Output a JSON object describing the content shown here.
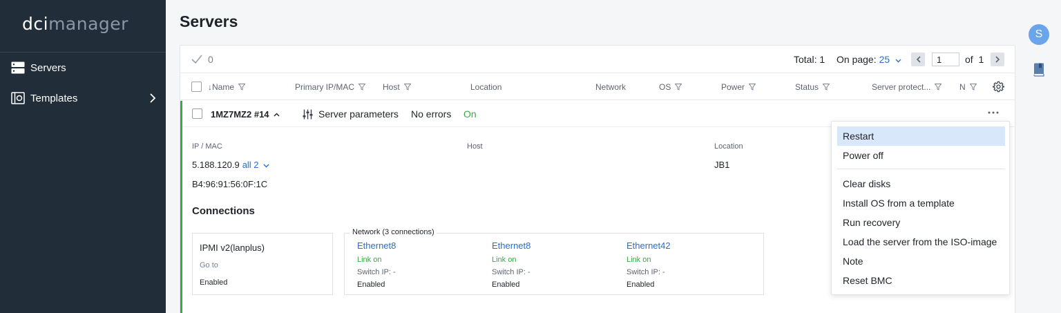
{
  "app": {
    "logo_part1": "dci",
    "logo_part2": "manager"
  },
  "sidebar": {
    "items": [
      {
        "label": "Servers",
        "icon": "servers-icon"
      },
      {
        "label": "Templates",
        "icon": "templates-icon"
      }
    ]
  },
  "user": {
    "avatar_letter": "S"
  },
  "page": {
    "title": "Servers"
  },
  "toolbar": {
    "selected_count": "0",
    "total": "Total: 1",
    "on_page_label": "On page:",
    "on_page_value": "25",
    "page_input": "1",
    "of_text": "of  1"
  },
  "table": {
    "columns": [
      "↓Name",
      "Primary IP/MAC",
      "Host",
      "Location",
      "Network",
      "OS",
      "Power",
      "Status",
      "Server protect...",
      "N"
    ]
  },
  "server": {
    "name": "1MZ7MZ2 #14",
    "params_label": "Server parameters",
    "errors": "No errors",
    "power": "On",
    "ipmac_label": "IP / MAC",
    "ip": "5.188.120.9",
    "all_link": "all 2",
    "mac": "B4:96:91:56:0F:1C",
    "host_label": "Host",
    "location_label": "Location",
    "location": "JB1",
    "connections_title": "Connections",
    "ipmi": {
      "title": "IPMI v2(lanplus)",
      "goto": "Go to",
      "status": "Enabled"
    },
    "network": {
      "legend": "Network (3 connections)",
      "ports": [
        {
          "name": "Ethernet8",
          "link": "Link on",
          "switch_ip": "Switch IP: -",
          "status": "Enabled"
        },
        {
          "name": "Ethernet8",
          "link": "Link on",
          "switch_ip": "Switch IP: -",
          "status": "Enabled"
        },
        {
          "name": "Ethernet42",
          "link": "Link on",
          "switch_ip": "Switch IP: -",
          "status": "Enabled"
        }
      ]
    }
  },
  "menu": {
    "items": [
      "Restart",
      "Power off",
      "Clear disks",
      "Install OS from a template",
      "Run recovery",
      "Load the server from the ISO-image",
      "Note",
      "Reset BMC"
    ],
    "active": "Restart"
  },
  "colors": {
    "sidebar_bg": "#222d3a",
    "accent": "#2a6ec9",
    "success": "#3aa845",
    "menu_highlight": "#d8e7f9"
  }
}
